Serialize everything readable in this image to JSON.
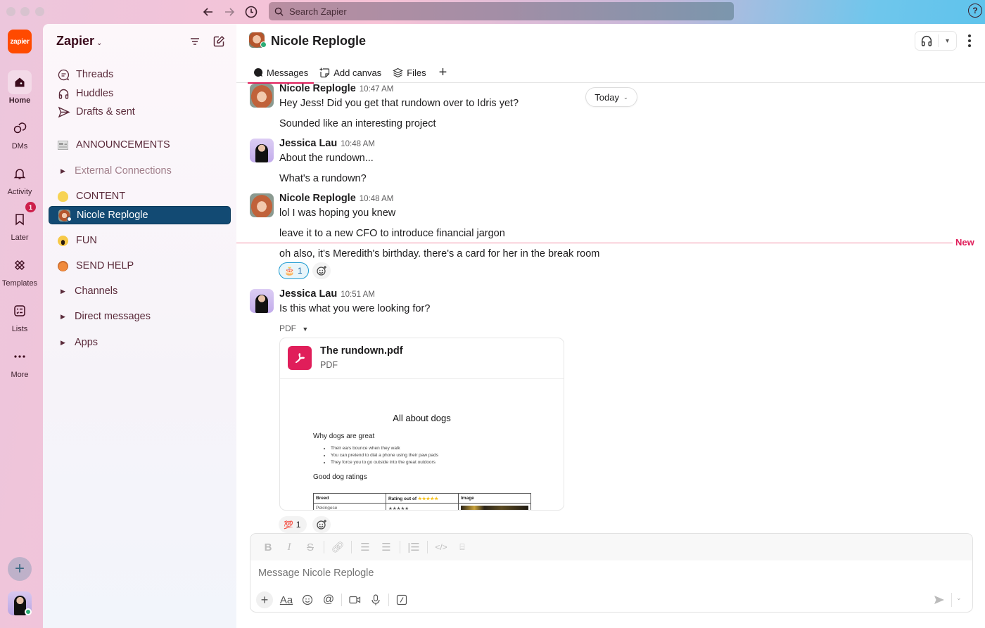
{
  "titlebar": {
    "search_placeholder": "Search Zapier",
    "help_label": "?"
  },
  "rail": {
    "logo_text": "zapier",
    "items": [
      {
        "label": "Home",
        "icon": "home-icon"
      },
      {
        "label": "DMs",
        "icon": "dms-icon"
      },
      {
        "label": "Activity",
        "icon": "bell-icon"
      },
      {
        "label": "Later",
        "icon": "bookmark-icon",
        "badge": "1"
      },
      {
        "label": "Templates",
        "icon": "templates-icon"
      },
      {
        "label": "Lists",
        "icon": "lists-icon"
      },
      {
        "label": "More",
        "icon": "more-icon"
      }
    ]
  },
  "sidebar": {
    "workspace": "Zapier",
    "nav": [
      {
        "label": "Threads"
      },
      {
        "label": "Huddles"
      },
      {
        "label": "Drafts & sent"
      }
    ],
    "sections": [
      {
        "label": "ANNOUNCEMENTS"
      },
      {
        "label": "External Connections"
      },
      {
        "label": "CONTENT"
      },
      {
        "label": "Nicole Replogle"
      },
      {
        "label": "FUN"
      },
      {
        "label": "SEND HELP"
      },
      {
        "label": "Channels"
      },
      {
        "label": "Direct messages"
      },
      {
        "label": "Apps"
      }
    ]
  },
  "channel": {
    "title": "Nicole Replogle",
    "tabs": [
      {
        "label": "Messages"
      },
      {
        "label": "Add canvas"
      },
      {
        "label": "Files"
      }
    ],
    "date_pill": "Today",
    "new_label": "New"
  },
  "messages": [
    {
      "author": "Nicole Replogle",
      "time": "10:47 AM",
      "lines": [
        "Hey Jess! Did you get that rundown over to Idris yet?",
        "Sounded like an interesting project"
      ]
    },
    {
      "author": "Jessica Lau",
      "time": "10:48 AM",
      "lines": [
        "About the rundown...",
        "What's a rundown?"
      ]
    },
    {
      "author": "Nicole Replogle",
      "time": "10:48 AM",
      "lines": [
        "lol I was hoping you knew",
        "leave it to a new CFO to introduce financial jargon",
        "oh also, it's Meredith's birthday. there's a card for her in the break room"
      ],
      "reaction": {
        "emoji": "🎂",
        "count": "1"
      }
    },
    {
      "author": "Jessica Lau",
      "time": "10:51 AM",
      "lines": [
        "Is this what you were looking for?"
      ],
      "attachment_toggle": "PDF",
      "reaction": {
        "emoji": "💯",
        "count": "1"
      }
    }
  ],
  "file": {
    "name": "The rundown.pdf",
    "type": "PDF",
    "preview": {
      "title": "All about dogs",
      "heading1": "Why dogs are great",
      "bullets": [
        "Their ears bounce when they walk",
        "You can pretend to dial a phone using their paw pads",
        "They force you to go outside into the great outdoors"
      ],
      "heading2": "Good dog ratings",
      "table_headers": [
        "Breed",
        "Rating out of ★★★★★",
        "Image"
      ],
      "table_rows": [
        [
          "Pekingese",
          "★★★★★",
          ""
        ]
      ]
    }
  },
  "composer": {
    "placeholder": "Message Nicole Replogle",
    "format_label": "Aa"
  },
  "colors": {
    "accent": "#e01e5a",
    "active_item": "#124a73",
    "zapier_orange": "#ff4a00",
    "presence": "#2bac76"
  }
}
